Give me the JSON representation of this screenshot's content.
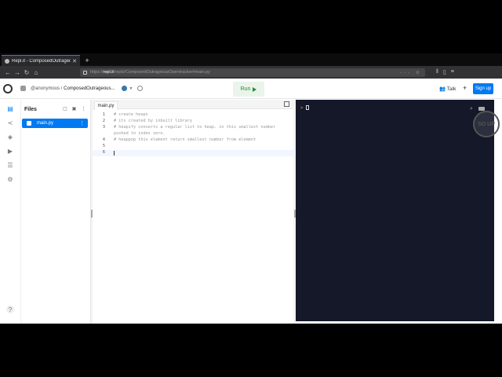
{
  "browser": {
    "tab_title": "Repl.it - ComposedOutrageousOpentracker",
    "url_prefix": "https://",
    "url_host": "repl.it",
    "url_path": "/repls/ComposedOutrageousOpentracker#main.py"
  },
  "header": {
    "user": "@anonymous",
    "separator": "/",
    "project": "ComposedOutrageous...",
    "run_label": "Run",
    "talk_label": "Talk",
    "plus_label": "+",
    "signup_label": "Sign up"
  },
  "files": {
    "title": "Files",
    "items": [
      {
        "name": "main.py"
      }
    ]
  },
  "editor": {
    "tab_label": "main.py",
    "lines": [
      {
        "num": "1",
        "text": "# create heaps"
      },
      {
        "num": "2",
        "text": "# its created by inbuilt library"
      },
      {
        "num": "3",
        "text": "# heapify converts a regular list to heap. in this smallest number"
      },
      {
        "num": "",
        "text": "pushed to index zero."
      },
      {
        "num": "4",
        "text": "# heappop this element return smallest number from element"
      },
      {
        "num": "5",
        "text": ""
      },
      {
        "num": "6",
        "text": ""
      }
    ]
  },
  "console": {
    "prompt": ">"
  },
  "watermark": {
    "text": "SO UP"
  },
  "colors": {
    "accent": "#0079f2",
    "run": "#2c8a3a",
    "console_bg": "#141829"
  }
}
